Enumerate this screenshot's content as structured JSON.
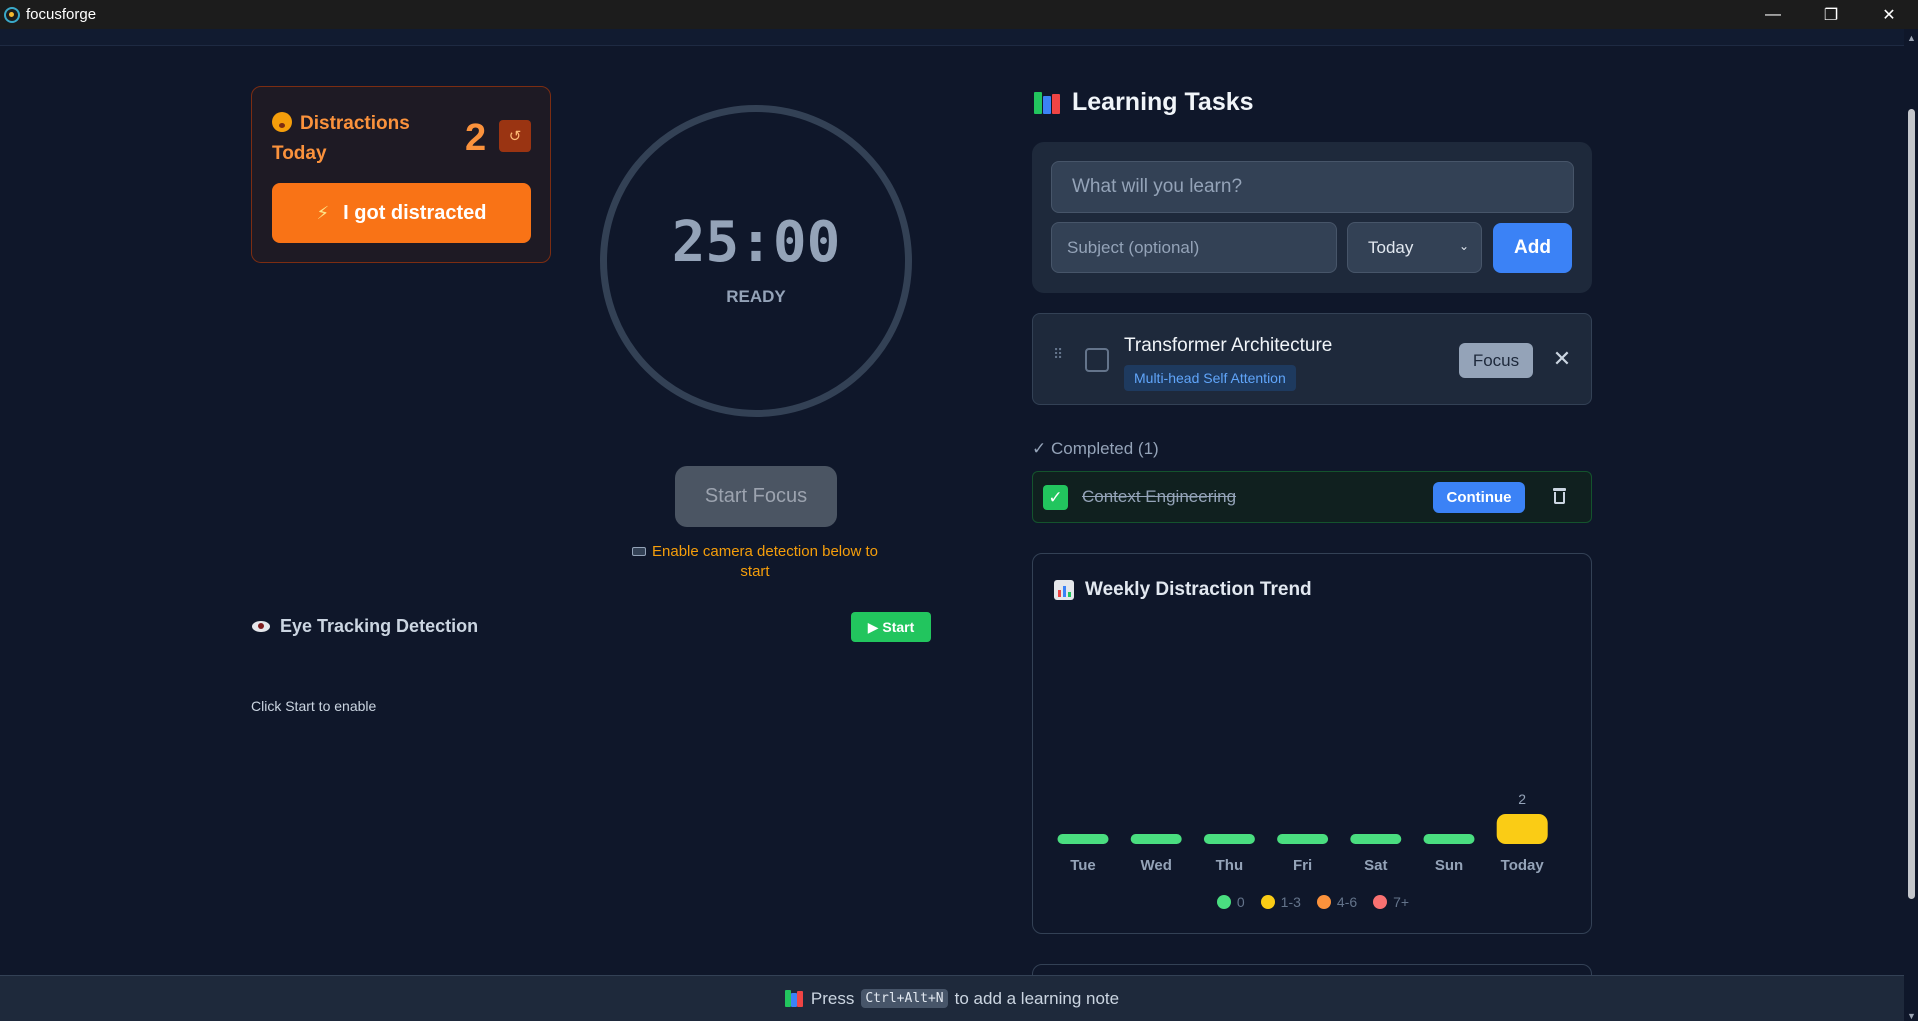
{
  "window": {
    "title": "focusforge",
    "minimize_glyph": "—",
    "restore_glyph": "❐",
    "close_glyph": "✕"
  },
  "distractions": {
    "title": "Distractions Today",
    "count": "2",
    "reset_glyph": "↺",
    "button_label": "I got distracted",
    "bolt_glyph": "⚡"
  },
  "timer": {
    "value": "25:00",
    "status": "READY",
    "start_label": "Start Focus",
    "camera_hint": "Enable camera detection below to start"
  },
  "eye_tracking": {
    "title": "Eye Tracking Detection",
    "start_label": "▶ Start",
    "hint": "Click Start to enable"
  },
  "tasks": {
    "title": "Learning Tasks",
    "input_placeholder": "What will you learn?",
    "subject_placeholder": "Subject (optional)",
    "day_selected": "Today",
    "add_label": "Add",
    "active": [
      {
        "name": "Transformer Architecture",
        "subject": "Multi-head Self Attention",
        "focus_label": "Focus",
        "remove_glyph": "✕"
      }
    ],
    "completed_label": "✓ Completed (1)",
    "completed": [
      {
        "name": "Context Engineering",
        "check_glyph": "✓",
        "continue_label": "Continue"
      }
    ]
  },
  "trend": {
    "title": "Weekly Distraction Trend",
    "legend": [
      {
        "label": "0",
        "color": "#4ade80"
      },
      {
        "label": "1-3",
        "color": "#facc15"
      },
      {
        "label": "4-6",
        "color": "#fb923c"
      },
      {
        "label": "7+",
        "color": "#f87171"
      }
    ]
  },
  "chart_data": {
    "type": "bar",
    "title": "Weekly Distraction Trend",
    "categories": [
      "Tue",
      "Wed",
      "Thu",
      "Fri",
      "Sat",
      "Sun",
      "Today"
    ],
    "values": [
      0,
      0,
      0,
      0,
      0,
      0,
      2
    ],
    "data_labels": [
      "",
      "",
      "",
      "",
      "",
      "",
      "2"
    ],
    "colors": [
      "#4ade80",
      "#4ade80",
      "#4ade80",
      "#4ade80",
      "#4ade80",
      "#4ade80",
      "#facc15"
    ]
  },
  "footer": {
    "prefix": "Press",
    "shortcut": "Ctrl+Alt+N",
    "suffix": "to add a learning note"
  }
}
